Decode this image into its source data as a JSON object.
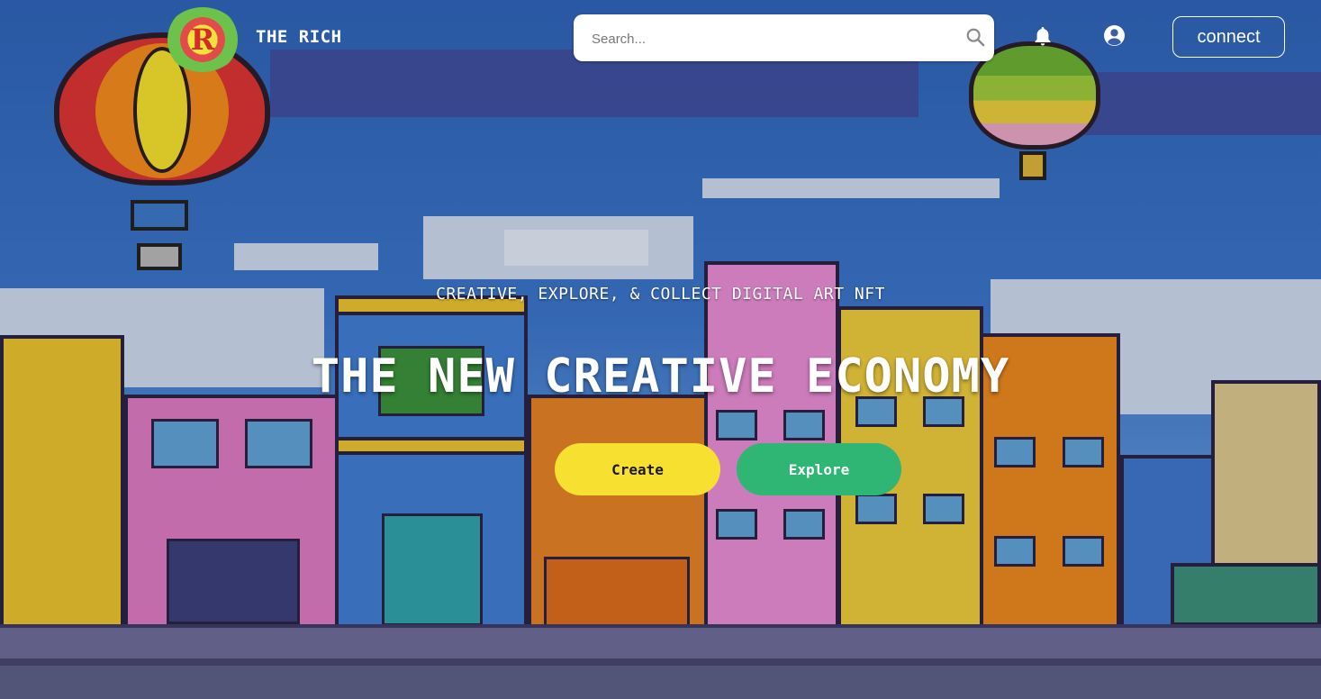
{
  "header": {
    "brand": "THE RICH",
    "search_placeholder": "Search...",
    "connect_label": "connect"
  },
  "hero": {
    "tagline": "CREATIVE, EXPLORE, & COLLECT DIGITAL ART NFT",
    "headline": "THE NEW CREATIVE ECONOMY",
    "create_label": "Create",
    "explore_label": "Explore"
  },
  "colors": {
    "create": "#f8e030",
    "explore": "#2fb574",
    "sky": "#3a73c7"
  },
  "icons": [
    "search-icon",
    "bell-icon",
    "user-icon"
  ]
}
